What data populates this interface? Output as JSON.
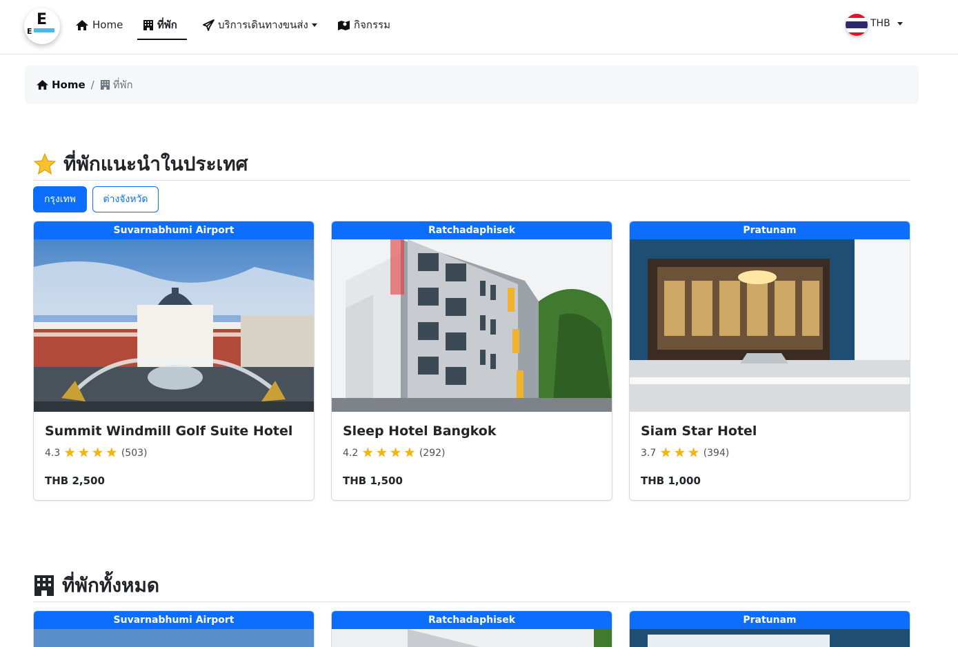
{
  "nav": {
    "logo_letter": "E",
    "logo_small": "E",
    "items": [
      {
        "label": "Home",
        "icon": "home-icon"
      },
      {
        "label": "ที่พัก",
        "icon": "building-icon"
      },
      {
        "label": "บริการเดินทางขนส่ง",
        "icon": "plane-icon"
      },
      {
        "label": "กิจกรรม",
        "icon": "map-icon"
      }
    ],
    "currency": "THB"
  },
  "breadcrumb": {
    "home": "Home",
    "current": "ที่พัก"
  },
  "recommended": {
    "title": "ที่พักแนะนำในประเทศ",
    "tabs": [
      "กรุงเทพ",
      "ต่างจังหวัด"
    ],
    "hotels": [
      {
        "area": "Suvarnabhumi Airport",
        "name": "Summit Windmill Golf Suite Hotel",
        "rating": "4.3",
        "stars": 4,
        "reviews": "(503)",
        "price": "THB 2,500"
      },
      {
        "area": "Ratchadaphisek",
        "name": "Sleep Hotel Bangkok",
        "rating": "4.2",
        "stars": 4,
        "reviews": "(292)",
        "price": "THB 1,500"
      },
      {
        "area": "Pratunam",
        "name": "Siam Star Hotel",
        "rating": "3.7",
        "stars": 3,
        "reviews": "(394)",
        "price": "THB 1,000"
      }
    ]
  },
  "all": {
    "title": "ที่พักทั้งหมด",
    "areas": [
      "Suvarnabhumi Airport",
      "Ratchadaphisek",
      "Pratunam"
    ]
  },
  "colors": {
    "primary": "#0d6efd",
    "star": "#f4b400"
  }
}
